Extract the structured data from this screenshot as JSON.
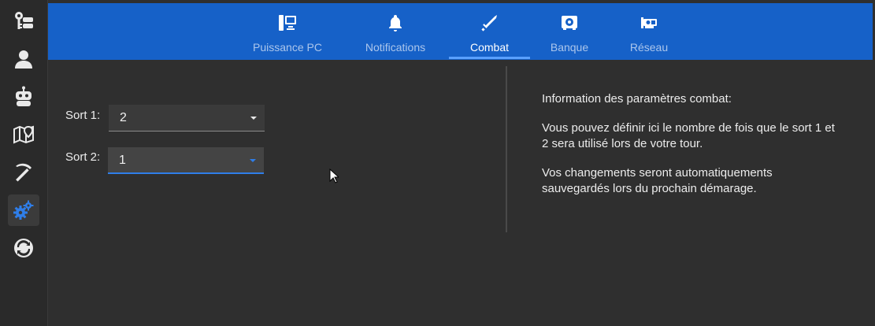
{
  "sidebar": {
    "items": [
      {
        "name": "keys-icon",
        "active": false
      },
      {
        "name": "user-icon",
        "active": false
      },
      {
        "name": "robot-icon",
        "active": false
      },
      {
        "name": "map-icon",
        "active": false
      },
      {
        "name": "pickaxe-icon",
        "active": false
      },
      {
        "name": "settings-gears-icon",
        "active": true
      },
      {
        "name": "sync-icon",
        "active": false
      }
    ]
  },
  "tabs": [
    {
      "label": "Puissance PC",
      "icon": "pc-icon"
    },
    {
      "label": "Notifications",
      "icon": "bell-icon"
    },
    {
      "label": "Combat",
      "icon": "sword-icon",
      "active": true
    },
    {
      "label": "Banque",
      "icon": "safe-icon"
    },
    {
      "label": "Réseau",
      "icon": "network-card-icon"
    }
  ],
  "form": {
    "sort1_label": "Sort 1:",
    "sort1_value": "2",
    "sort2_label": "Sort 2:",
    "sort2_value": "1"
  },
  "info": {
    "title": "Information des paramètres combat:",
    "p1": "Vous pouvez définir ici le nombre de fois que le sort 1 et 2 sera utilisé lors de votre tour.",
    "p2": "Vos changements seront automatiquements sauvegardés lors du prochain démarage."
  },
  "colors": {
    "topbar": "#1661c8",
    "accent": "#2f7ee9",
    "background": "#2f2f2f"
  }
}
